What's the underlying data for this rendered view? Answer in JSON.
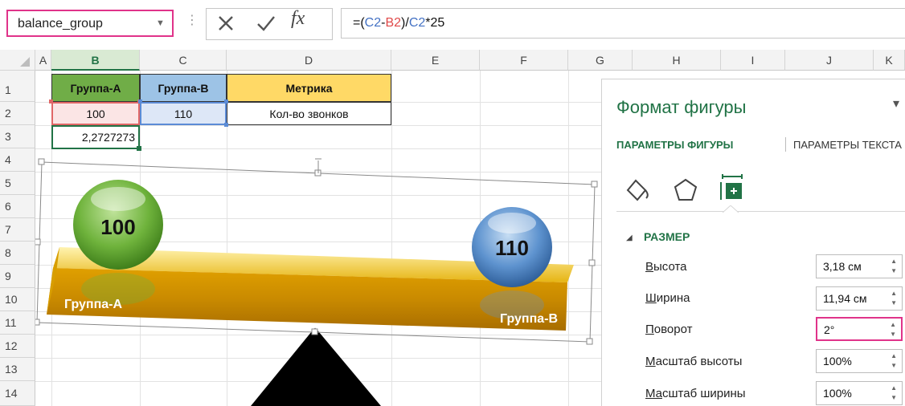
{
  "formula_bar": {
    "name_box": "balance_group",
    "formula_parts": [
      "=(",
      "C2",
      "-",
      "B2",
      ")/",
      "C2",
      "*25"
    ]
  },
  "grid": {
    "columns": [
      "A",
      "B",
      "C",
      "D",
      "E",
      "F",
      "G",
      "H",
      "I",
      "J",
      "K"
    ],
    "rows": [
      "1",
      "2",
      "3",
      "4",
      "5",
      "6",
      "7",
      "8",
      "9",
      "10",
      "11",
      "12",
      "13",
      "14"
    ]
  },
  "cells": {
    "b1": "Группа-А",
    "c1": "Группа-В",
    "d1": "Метрика",
    "b2": "100",
    "c2": "110",
    "d2": "Кол-во звонков",
    "b3": "2,2727273"
  },
  "shape": {
    "left_ball": "100",
    "right_ball": "110",
    "left_label": "Группа-А",
    "right_label": "Группа-В"
  },
  "panel": {
    "title": "Формат фигуры",
    "tab_active": "ПАРАМЕТРЫ ФИГУРЫ",
    "tab_other": "ПАРАМЕТРЫ ТЕКСТА",
    "section": "РАЗМЕР",
    "props": [
      {
        "label_first": "В",
        "label_rest": "ысота",
        "value": "3,18 см"
      },
      {
        "label_first": "Ш",
        "label_rest": "ирина",
        "value": "11,94 см"
      },
      {
        "label_first": "П",
        "label_rest": "оворот",
        "value": "2°"
      },
      {
        "label_first": "М",
        "label_rest": "асштаб высоты",
        "value": "100%"
      },
      {
        "label_first": "Ма",
        "label_rest": "сштаб ширины",
        "value": "100%",
        "underline_second": true
      }
    ]
  },
  "colors": {
    "excel_green": "#217346",
    "highlight_pink": "#e0338a",
    "header_green": "#70ad47",
    "header_blue": "#9dc3e6",
    "header_gold": "#ffd966"
  }
}
